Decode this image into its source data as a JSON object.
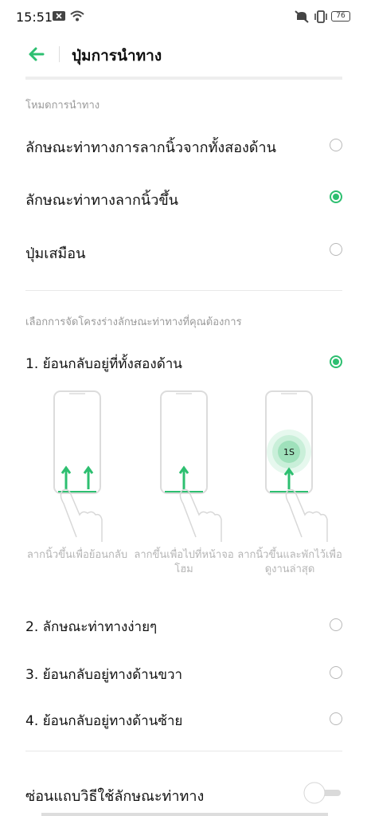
{
  "status_bar": {
    "time": "15:51",
    "battery": "76"
  },
  "header": {
    "title": "ปุ่มการนำทาง"
  },
  "sections": {
    "nav_mode": "โหมดการนำทาง",
    "gesture_layout": "เลือกการจัดโครงร่างลักษณะท่าทางที่คุณต้องการ"
  },
  "nav_modes": [
    {
      "label": "ลักษณะท่าทางการลากนิ้วจากทั้งสองด้าน",
      "selected": false
    },
    {
      "label": "ลักษณะท่าทางลากนิ้วขึ้น",
      "selected": true
    },
    {
      "label": "ปุ่มเสมือน",
      "selected": false
    }
  ],
  "layouts": [
    {
      "label": "1. ย้อนกลับอยู่ที่ทั้งสองด้าน",
      "selected": true
    },
    {
      "label": "2. ลักษณะท่าทางง่ายๆ",
      "selected": false
    },
    {
      "label": "3. ย้อนกลับอยู่ทางด้านขวา",
      "selected": false
    },
    {
      "label": "4. ย้อนกลับอยู่ทางด้านซ้าย",
      "selected": false
    }
  ],
  "illustrations": [
    {
      "caption": "ลากนิ้วขึ้นเพื่อย้อนกลับ"
    },
    {
      "caption": "ลากขึ้นเพื่อไปที่หน้าจอโฮม"
    },
    {
      "caption": "ลากนิ้วขึ้นและพักไว้เพื่อดูงานล่าสุด",
      "badge": "1S"
    }
  ],
  "hide_bar": {
    "label": "ซ่อนแถบวิธีใช้ลักษณะท่าทาง",
    "enabled": false
  },
  "colors": {
    "accent": "#2dbf70",
    "text": "#111111",
    "muted": "#9a9a9a"
  },
  "icons": [
    "no-sound-icon",
    "vibrate-icon",
    "battery-icon",
    "wifi-icon",
    "notification-icon",
    "back-arrow-icon",
    "swipe-up-arrow-icon"
  ]
}
